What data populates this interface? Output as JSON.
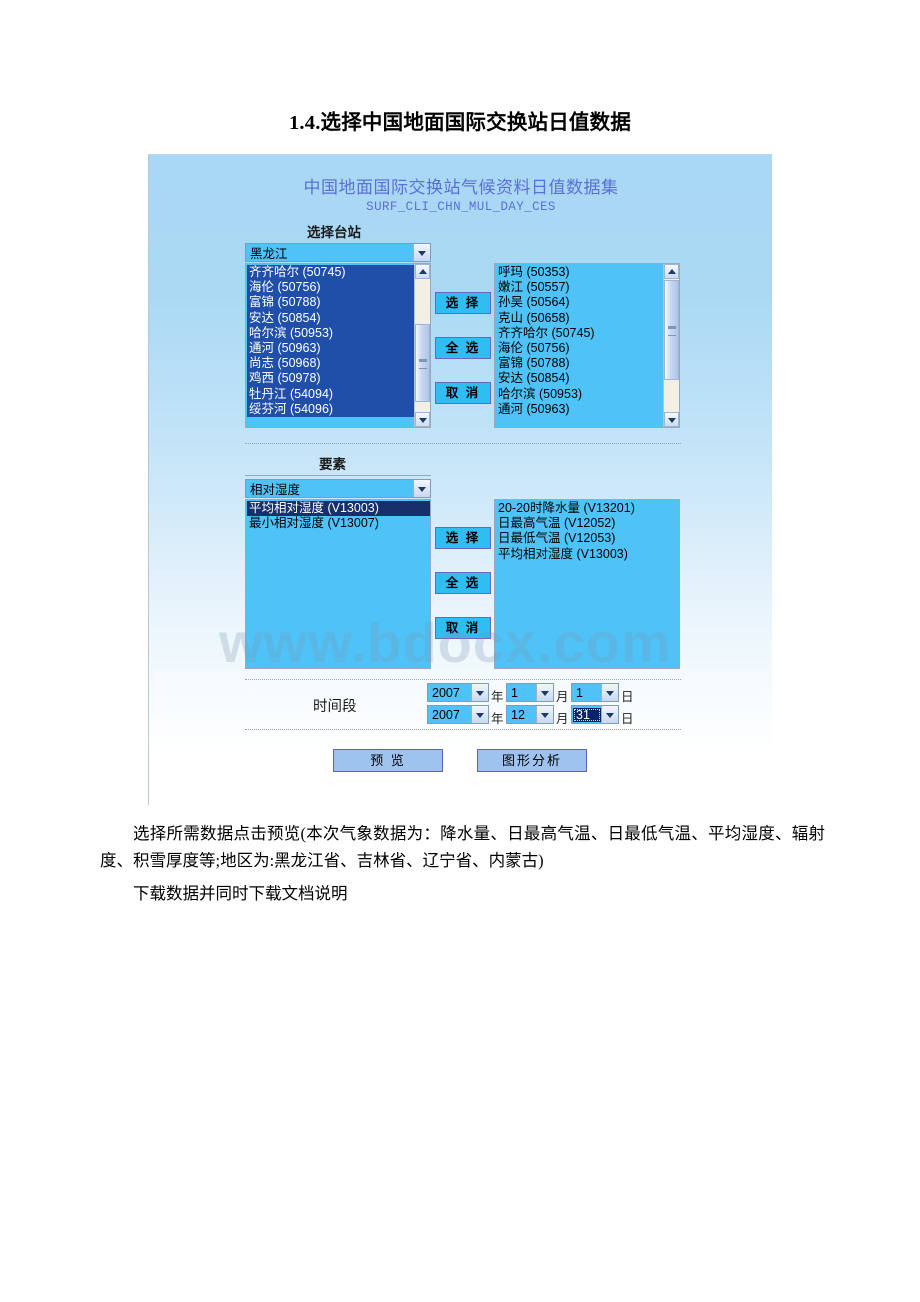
{
  "document": {
    "heading": "1.4.选择中国地面国际交换站日值数据",
    "paragraph1": "选择所需数据点击预览(本次气象数据为：降水量、日最高气温、日最低气温、平均湿度、辐射度、积雪厚度等;地区为:黑龙江省、吉林省、辽宁省、内蒙古)",
    "paragraph2": "下载数据并同时下载文档说明"
  },
  "app": {
    "title": "中国地面国际交换站气候资料日值数据集",
    "subtitle": "SURF_CLI_CHN_MUL_DAY_CES",
    "accent_color": "#5b6fd4",
    "panel_bg_top": "#a9d8f4",
    "listbox_bg": "#4fc3f7",
    "button_bg": "#30bdf2"
  },
  "station_section": {
    "label": "选择台站",
    "province_select": {
      "value": "黑龙江",
      "icon": "chevron-down-icon"
    },
    "available": [
      "齐齐哈尔 (50745)",
      "海伦 (50756)",
      "富锦 (50788)",
      "安达 (50854)",
      "哈尔滨 (50953)",
      "通河 (50963)",
      "尚志 (50968)",
      "鸡西 (50978)",
      "牡丹江 (54094)",
      "绥芬河 (54096)"
    ],
    "selected": [
      "呼玛 (50353)",
      "嫩江 (50557)",
      "孙吴 (50564)",
      "克山 (50658)",
      "齐齐哈尔 (50745)",
      "海伦 (50756)",
      "富锦 (50788)",
      "安达 (50854)",
      "哈尔滨 (50953)",
      "通河 (50963)"
    ],
    "buttons": {
      "choose": "选 择",
      "select_all": "全 选",
      "cancel": "取 消"
    }
  },
  "element_section": {
    "label": "要素",
    "category_select": {
      "value": "相对湿度",
      "icon": "chevron-down-icon"
    },
    "available": [
      "平均相对湿度 (V13003)",
      "最小相对湿度 (V13007)"
    ],
    "selected": [
      "20-20时降水量 (V13201)",
      "日最高气温 (V12052)",
      "日最低气温 (V12053)",
      "平均相对湿度 (V13003)"
    ],
    "buttons": {
      "choose": "选 择",
      "select_all": "全 选",
      "cancel": "取 消"
    }
  },
  "period_section": {
    "label": "时间段",
    "units": {
      "year": "年",
      "month": "月",
      "day": "日"
    },
    "start": {
      "year": "2007",
      "month": "1",
      "day": "1"
    },
    "end": {
      "year": "2007",
      "month": "12",
      "day": "31"
    }
  },
  "actions": {
    "preview": "预 览",
    "chart_analysis": "图形分析"
  },
  "watermark": "www.bdocx.com"
}
